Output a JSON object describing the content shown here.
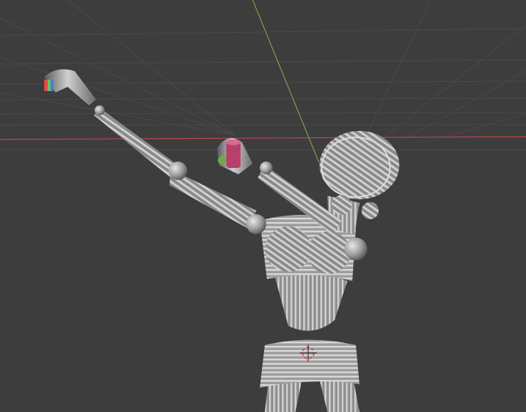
{
  "viewport": {
    "background": "#3d3d3d",
    "grid_color": "#4a4a4a",
    "x_axis_color": "#c0454f",
    "y_axis_color": "#7fa34a",
    "model_color": "#b9b9b9",
    "accent_color": "#b8406a",
    "icons": {
      "origin": "3d-cursor-icon"
    }
  }
}
